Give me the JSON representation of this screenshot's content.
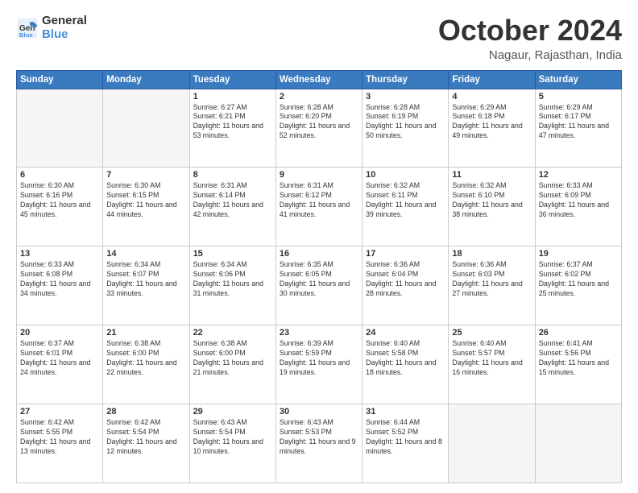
{
  "header": {
    "logo_line1": "General",
    "logo_line2": "Blue",
    "month": "October 2024",
    "location": "Nagaur, Rajasthan, India"
  },
  "weekdays": [
    "Sunday",
    "Monday",
    "Tuesday",
    "Wednesday",
    "Thursday",
    "Friday",
    "Saturday"
  ],
  "weeks": [
    [
      {
        "day": "",
        "empty": true
      },
      {
        "day": "",
        "empty": true
      },
      {
        "day": "1",
        "sunrise": "6:27 AM",
        "sunset": "6:21 PM",
        "daylight": "11 hours and 53 minutes."
      },
      {
        "day": "2",
        "sunrise": "6:28 AM",
        "sunset": "6:20 PM",
        "daylight": "11 hours and 52 minutes."
      },
      {
        "day": "3",
        "sunrise": "6:28 AM",
        "sunset": "6:19 PM",
        "daylight": "11 hours and 50 minutes."
      },
      {
        "day": "4",
        "sunrise": "6:29 AM",
        "sunset": "6:18 PM",
        "daylight": "11 hours and 49 minutes."
      },
      {
        "day": "5",
        "sunrise": "6:29 AM",
        "sunset": "6:17 PM",
        "daylight": "11 hours and 47 minutes."
      }
    ],
    [
      {
        "day": "6",
        "sunrise": "6:30 AM",
        "sunset": "6:16 PM",
        "daylight": "11 hours and 45 minutes."
      },
      {
        "day": "7",
        "sunrise": "6:30 AM",
        "sunset": "6:15 PM",
        "daylight": "11 hours and 44 minutes."
      },
      {
        "day": "8",
        "sunrise": "6:31 AM",
        "sunset": "6:14 PM",
        "daylight": "11 hours and 42 minutes."
      },
      {
        "day": "9",
        "sunrise": "6:31 AM",
        "sunset": "6:12 PM",
        "daylight": "11 hours and 41 minutes."
      },
      {
        "day": "10",
        "sunrise": "6:32 AM",
        "sunset": "6:11 PM",
        "daylight": "11 hours and 39 minutes."
      },
      {
        "day": "11",
        "sunrise": "6:32 AM",
        "sunset": "6:10 PM",
        "daylight": "11 hours and 38 minutes."
      },
      {
        "day": "12",
        "sunrise": "6:33 AM",
        "sunset": "6:09 PM",
        "daylight": "11 hours and 36 minutes."
      }
    ],
    [
      {
        "day": "13",
        "sunrise": "6:33 AM",
        "sunset": "6:08 PM",
        "daylight": "11 hours and 34 minutes."
      },
      {
        "day": "14",
        "sunrise": "6:34 AM",
        "sunset": "6:07 PM",
        "daylight": "11 hours and 33 minutes."
      },
      {
        "day": "15",
        "sunrise": "6:34 AM",
        "sunset": "6:06 PM",
        "daylight": "11 hours and 31 minutes."
      },
      {
        "day": "16",
        "sunrise": "6:35 AM",
        "sunset": "6:05 PM",
        "daylight": "11 hours and 30 minutes."
      },
      {
        "day": "17",
        "sunrise": "6:36 AM",
        "sunset": "6:04 PM",
        "daylight": "11 hours and 28 minutes."
      },
      {
        "day": "18",
        "sunrise": "6:36 AM",
        "sunset": "6:03 PM",
        "daylight": "11 hours and 27 minutes."
      },
      {
        "day": "19",
        "sunrise": "6:37 AM",
        "sunset": "6:02 PM",
        "daylight": "11 hours and 25 minutes."
      }
    ],
    [
      {
        "day": "20",
        "sunrise": "6:37 AM",
        "sunset": "6:01 PM",
        "daylight": "11 hours and 24 minutes."
      },
      {
        "day": "21",
        "sunrise": "6:38 AM",
        "sunset": "6:00 PM",
        "daylight": "11 hours and 22 minutes."
      },
      {
        "day": "22",
        "sunrise": "6:38 AM",
        "sunset": "6:00 PM",
        "daylight": "11 hours and 21 minutes."
      },
      {
        "day": "23",
        "sunrise": "6:39 AM",
        "sunset": "5:59 PM",
        "daylight": "11 hours and 19 minutes."
      },
      {
        "day": "24",
        "sunrise": "6:40 AM",
        "sunset": "5:58 PM",
        "daylight": "11 hours and 18 minutes."
      },
      {
        "day": "25",
        "sunrise": "6:40 AM",
        "sunset": "5:57 PM",
        "daylight": "11 hours and 16 minutes."
      },
      {
        "day": "26",
        "sunrise": "6:41 AM",
        "sunset": "5:56 PM",
        "daylight": "11 hours and 15 minutes."
      }
    ],
    [
      {
        "day": "27",
        "sunrise": "6:42 AM",
        "sunset": "5:55 PM",
        "daylight": "11 hours and 13 minutes."
      },
      {
        "day": "28",
        "sunrise": "6:42 AM",
        "sunset": "5:54 PM",
        "daylight": "11 hours and 12 minutes."
      },
      {
        "day": "29",
        "sunrise": "6:43 AM",
        "sunset": "5:54 PM",
        "daylight": "11 hours and 10 minutes."
      },
      {
        "day": "30",
        "sunrise": "6:43 AM",
        "sunset": "5:53 PM",
        "daylight": "11 hours and 9 minutes."
      },
      {
        "day": "31",
        "sunrise": "6:44 AM",
        "sunset": "5:52 PM",
        "daylight": "11 hours and 8 minutes."
      },
      {
        "day": "",
        "empty": true
      },
      {
        "day": "",
        "empty": true
      }
    ]
  ]
}
